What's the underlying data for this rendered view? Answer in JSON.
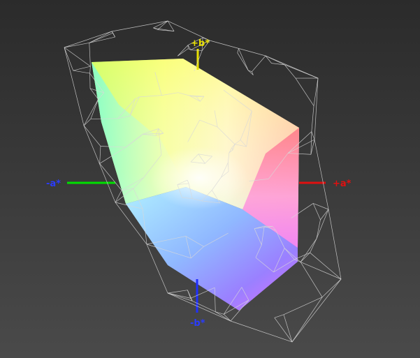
{
  "axes": {
    "pos_b": {
      "label": "+b*",
      "color": "#e8e000"
    },
    "neg_b": {
      "label": "-b*",
      "color": "#2a3cff"
    },
    "pos_a": {
      "label": "+a*",
      "color": "#e01010"
    },
    "neg_a": {
      "label": "-a*",
      "color": "#2a3cff",
      "line_color": "#00e000"
    }
  },
  "wireframe_color": "#d8d8d8"
}
